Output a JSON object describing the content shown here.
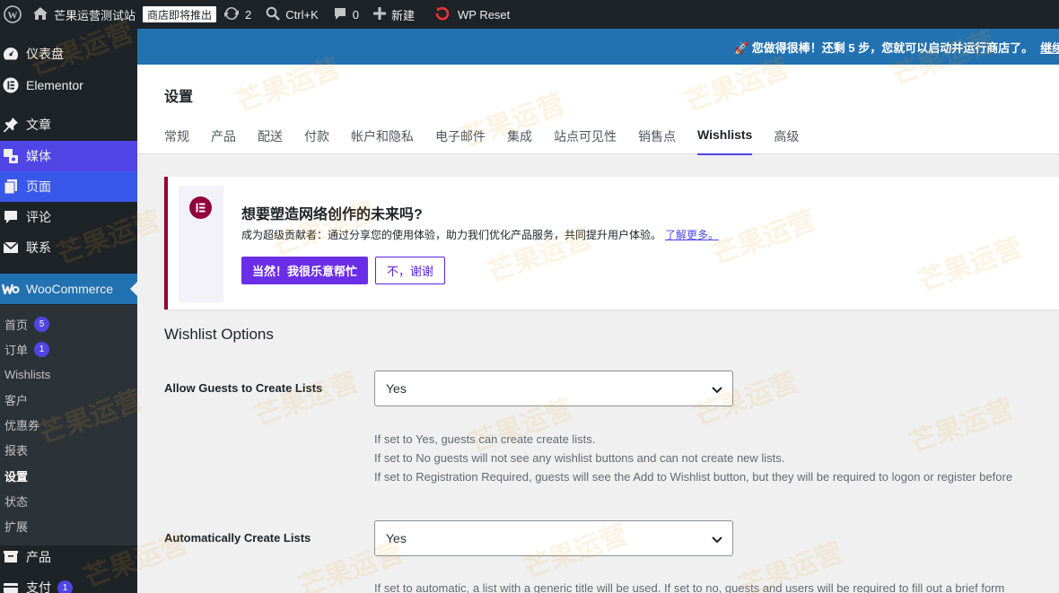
{
  "adminbar": {
    "site_name": "芒果运营测试站",
    "store_badge": "商店即将推出",
    "updates_count": "2",
    "search_shortcut": "Ctrl+K",
    "comments_count": "0",
    "new_label": "新建",
    "wp_reset_label": "WP Reset"
  },
  "sidebar": {
    "items": [
      {
        "label": "仪表盘",
        "icon": "dashboard-icon"
      },
      {
        "label": "Elementor",
        "icon": "elementor-icon"
      },
      {
        "label": "文章",
        "icon": "pin-icon"
      },
      {
        "label": "媒体",
        "icon": "media-icon"
      },
      {
        "label": "页面",
        "icon": "pages-icon"
      },
      {
        "label": "评论",
        "icon": "comment-icon"
      },
      {
        "label": "联系",
        "icon": "mail-icon"
      },
      {
        "label": "WooCommerce",
        "icon": "woo-icon"
      }
    ],
    "submenu": [
      {
        "label": "首页",
        "count": "5"
      },
      {
        "label": "订单",
        "count": "1"
      },
      {
        "label": "Wishlists"
      },
      {
        "label": "客户"
      },
      {
        "label": "优惠券"
      },
      {
        "label": "报表"
      },
      {
        "label": "设置"
      },
      {
        "label": "状态"
      },
      {
        "label": "扩展"
      }
    ],
    "after": [
      {
        "label": "产品",
        "icon": "products-icon"
      },
      {
        "label": "支付",
        "icon": "payments-icon",
        "count": "1"
      }
    ]
  },
  "notice": {
    "text": "🚀 您做得很棒！还剩 5 步，您就可以启动并运行商店了。",
    "link": "继续"
  },
  "header": {
    "title": "设置",
    "tabs": [
      "常规",
      "产品",
      "配送",
      "付款",
      "帐户和隐私",
      "电子邮件",
      "集成",
      "站点可见性",
      "销售点",
      "Wishlists",
      "高级"
    ],
    "active_tab": "Wishlists"
  },
  "promo": {
    "title": "想要塑造网络创作的未来吗?",
    "text": "成为超级贡献者：通过分享您的使用体验，助力我们优化产品服务，共同提升用户体验。",
    "link": "了解更多。",
    "accept": "当然！我很乐意帮忙",
    "decline": "不，谢谢"
  },
  "wishlist": {
    "section_title": "Wishlist Options",
    "fields": [
      {
        "label": "Allow Guests to Create Lists",
        "value": "Yes",
        "desc": [
          "If set to Yes, guests can create create lists.",
          "If set to No guests will not see any wishlist buttons and can not create new lists.",
          "If set to Registration Required, guests will see the Add to Wishlist button, but they will be required to logon or register before"
        ]
      },
      {
        "label": "Automatically Create Lists",
        "value": "Yes",
        "desc": [
          "If set to automatic, a list with a generic title will be used. If set to no, guests and users will be required to fill out a brief form"
        ]
      }
    ]
  },
  "watermark": "芒果运营",
  "colors": {
    "admin_dark": "#1d2327",
    "notice_blue": "#2271b1",
    "accent_purple": "#6a2ee8",
    "elementor_red": "#92003b"
  }
}
